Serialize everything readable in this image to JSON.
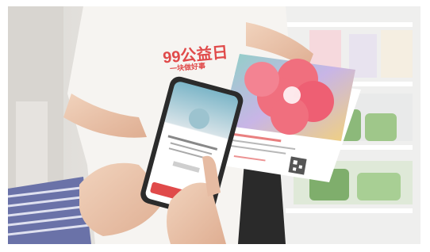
{
  "photo": {
    "shirt_text": "99公益日",
    "shirt_subtext": "一块做好事",
    "colors": {
      "background": "#e9e7e4",
      "shirt": "#f6f4f1",
      "logo_red": "#e04a4a",
      "flower_pink": "#f06f7e",
      "card_gradient_teal": "#8ed1c6",
      "phone_body": "#2b2b2b",
      "shelf": "#f2f2f2",
      "green_items": "#8cb97a"
    },
    "icons": [
      "phone-screen",
      "flower-card",
      "qr-code"
    ]
  }
}
